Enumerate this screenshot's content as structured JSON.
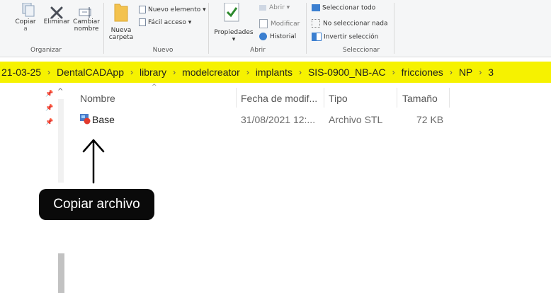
{
  "ribbon": {
    "organizar": {
      "copiar_line1": "Copiar",
      "copiar_line2": "a",
      "eliminar": "Eliminar",
      "cambiar_line1": "Cambiar",
      "cambiar_line2": "nombre",
      "group_label": "Organizar"
    },
    "nuevo": {
      "carpeta_line1": "Nueva",
      "carpeta_line2": "carpeta",
      "nuevo_elemento": "Nuevo elemento",
      "facil_acceso": "Fácil acceso",
      "group_label": "Nuevo"
    },
    "abrir": {
      "propiedades": "Propiedades",
      "abrir": "Abrir",
      "modificar": "Modificar",
      "historial": "Historial",
      "group_label": "Abrir"
    },
    "seleccionar": {
      "todo": "Seleccionar todo",
      "nada": "No seleccionar nada",
      "invertir": "Invertir selección",
      "group_label": "Seleccionar"
    }
  },
  "address_bar": {
    "segments": [
      "21-03-25",
      "DentalCADApp",
      "library",
      "modelcreator",
      "implants",
      "SIS-0900_NB-AC",
      "fricciones",
      "NP",
      "3"
    ],
    "separator": "›",
    "highlight_color": "#f6f200"
  },
  "file_list": {
    "columns": {
      "name": "Nombre",
      "date": "Fecha de modif...",
      "type": "Tipo",
      "size": "Tamaño"
    },
    "rows": [
      {
        "name": "Base",
        "date": "31/08/2021 12:...",
        "type": "Archivo STL",
        "size": "72 KB"
      }
    ]
  },
  "annotation": {
    "label": "Copiar archivo"
  }
}
